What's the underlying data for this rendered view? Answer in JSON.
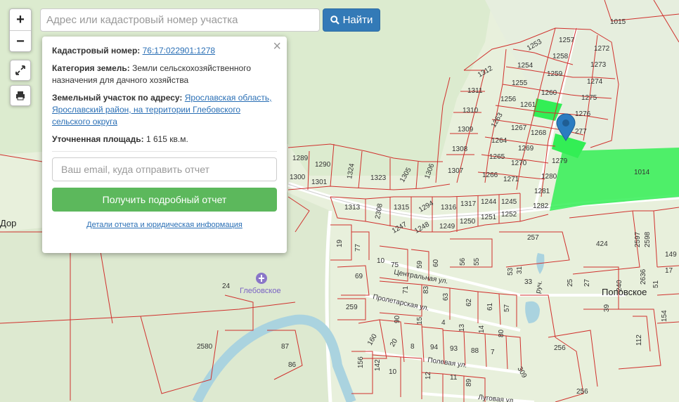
{
  "search": {
    "placeholder": "Адрес или кадастровый номер участка",
    "button_label": "Найти"
  },
  "controls": {
    "zoom_in": "+",
    "zoom_out": "−"
  },
  "popup": {
    "cad_label": "Кадастровый номер:",
    "cad_value": "76:17:022901:1278",
    "category_label": "Категория земель:",
    "category_value": "Земли сельскохозяйственного назначения для дачного хозяйства",
    "address_label": "Земельный участок по адресу:",
    "address_value": "Ярославская область, Ярославский район, на территории Глебовского сельского округа",
    "area_label": "Уточненная площадь:",
    "area_value": "1 615 кв.м.",
    "close": "×",
    "email_placeholder": "Ваш email, куда отправить отчет",
    "report_button": "Получить подробный отчет",
    "details_link": "Детали отчета и юридическая информация"
  },
  "map": {
    "colors": {
      "parcel_border": "#d0312d",
      "selected_fill": "#33ee55",
      "water": "#aad3df",
      "road": "#ffffff",
      "marker": "#2b7cc1",
      "place_icon": "#8a76c8"
    },
    "place_label": "Глебовское",
    "village_label": "Поповское",
    "edge_label": "Дор",
    "streets": [
      "Центральная ул.",
      "Пролетарская ул.",
      "Полевая ул.",
      "Луговая ул.",
      "руч."
    ],
    "parcels": [
      "1015",
      "1257",
      "1272",
      "1253",
      "1258",
      "1254",
      "1273",
      "1259",
      "1312",
      "1255",
      "1274",
      "1260",
      "1311",
      "1256",
      "1275",
      "1261",
      "1276",
      "1310",
      "1263",
      "1267",
      "1268",
      "277",
      "1309",
      "1264",
      "1269",
      "1279",
      "1308",
      "1265",
      "1270",
      "1289",
      "1290",
      "1324",
      "1323",
      "1305",
      "1306",
      "1307",
      "1266",
      "1271",
      "1280",
      "1014",
      "1300",
      "1301",
      "1281",
      "1313",
      "2308",
      "1315",
      "1294",
      "1316",
      "1317",
      "1244",
      "1245",
      "1282",
      "1247",
      "1248",
      "1249",
      "1250",
      "1251",
      "1252",
      "257",
      "424",
      "2597",
      "2598",
      "19",
      "77",
      "10",
      "75",
      "59",
      "60",
      "56",
      "55",
      "53",
      "149",
      "17",
      "69",
      "71",
      "83",
      "63",
      "62",
      "61",
      "57",
      "33",
      "31",
      "25",
      "27",
      "240",
      "2636",
      "51",
      "259",
      "90",
      "15",
      "4",
      "13",
      "14",
      "80",
      "39",
      "154",
      "160",
      "20",
      "8",
      "94",
      "93",
      "88",
      "7",
      "112",
      "156",
      "142",
      "10",
      "309",
      "256",
      "12",
      "11",
      "89",
      "256",
      "24",
      "2580",
      "87",
      "86"
    ]
  }
}
